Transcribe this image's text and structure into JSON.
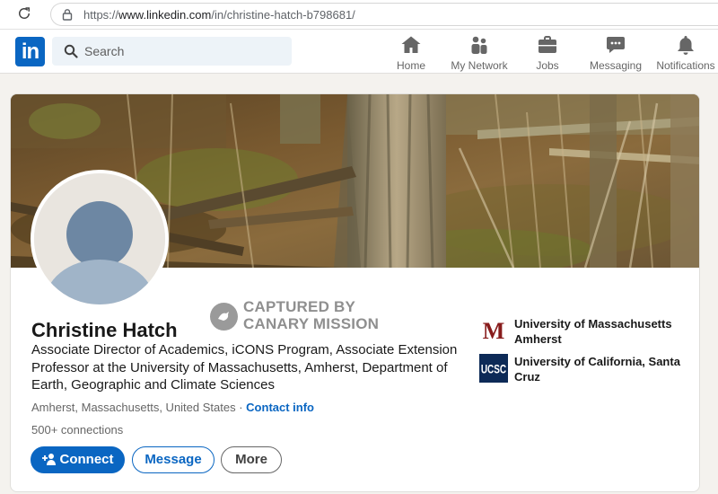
{
  "browser": {
    "url_prefix": "https://",
    "url_domain": "www.linkedin.com",
    "url_path": "/in/christine-hatch-b798681/"
  },
  "nav": {
    "logo": "in",
    "search_placeholder": "Search",
    "items": [
      {
        "label": "Home",
        "icon": "home-icon"
      },
      {
        "label": "My Network",
        "icon": "network-icon"
      },
      {
        "label": "Jobs",
        "icon": "briefcase-icon"
      },
      {
        "label": "Messaging",
        "icon": "chat-icon"
      },
      {
        "label": "Notifications",
        "icon": "bell-icon"
      }
    ]
  },
  "watermark": {
    "line1": "CAPTURED BY",
    "line2": "CANARY MISSION"
  },
  "profile": {
    "name": "Christine Hatch",
    "headline": "Associate Director of Academics, iCONS Program, Associate Extension Professor at the University of Massachusetts, Amherst, Department of Earth, Geographic and Climate Sciences",
    "location": "Amherst, Massachusetts, United States",
    "separator": " · ",
    "contact_info": "Contact info",
    "connections": "500+ connections"
  },
  "actions": {
    "connect": "Connect",
    "message": "Message",
    "more": "More"
  },
  "education": [
    {
      "name": "University of Massachusetts Amherst",
      "logo_text": "M",
      "logo_color": "#881c1c"
    },
    {
      "name": "University of California, Santa Cruz",
      "logo_text": "UCSC",
      "logo_color": "#0d2a57"
    }
  ],
  "colors": {
    "brand": "#0a66c2",
    "text": "#191919",
    "muted": "#666666"
  }
}
